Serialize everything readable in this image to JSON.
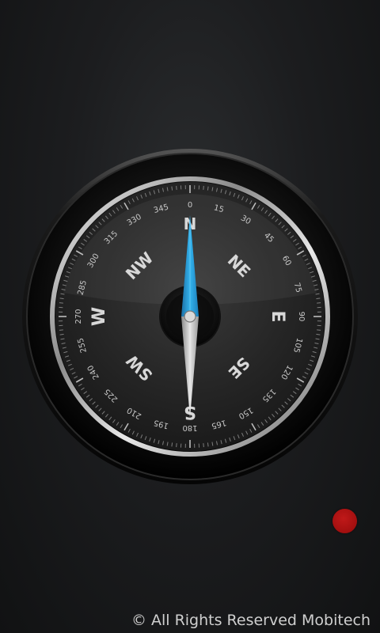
{
  "compass": {
    "cardinals": {
      "north": "N",
      "east": "E",
      "south": "S",
      "west": "W"
    },
    "intercardinals": {
      "northeast": "NE",
      "southeast": "SE",
      "southwest": "SW",
      "northwest": "NW"
    },
    "degree_labels": [
      "0",
      "15",
      "30",
      "45",
      "60",
      "75",
      "90",
      "105",
      "120",
      "135",
      "150",
      "165",
      "180",
      "195",
      "210",
      "225",
      "240",
      "255",
      "270",
      "285",
      "300",
      "315",
      "330",
      "345"
    ],
    "heading_degrees": 0,
    "needle_north_color": "#2fa6e0",
    "needle_south_color": "#c9c9c9"
  },
  "record_indicator": {
    "color": "#b01414"
  },
  "footer": {
    "copyright": "© All Rights Reserved Mobitech"
  }
}
